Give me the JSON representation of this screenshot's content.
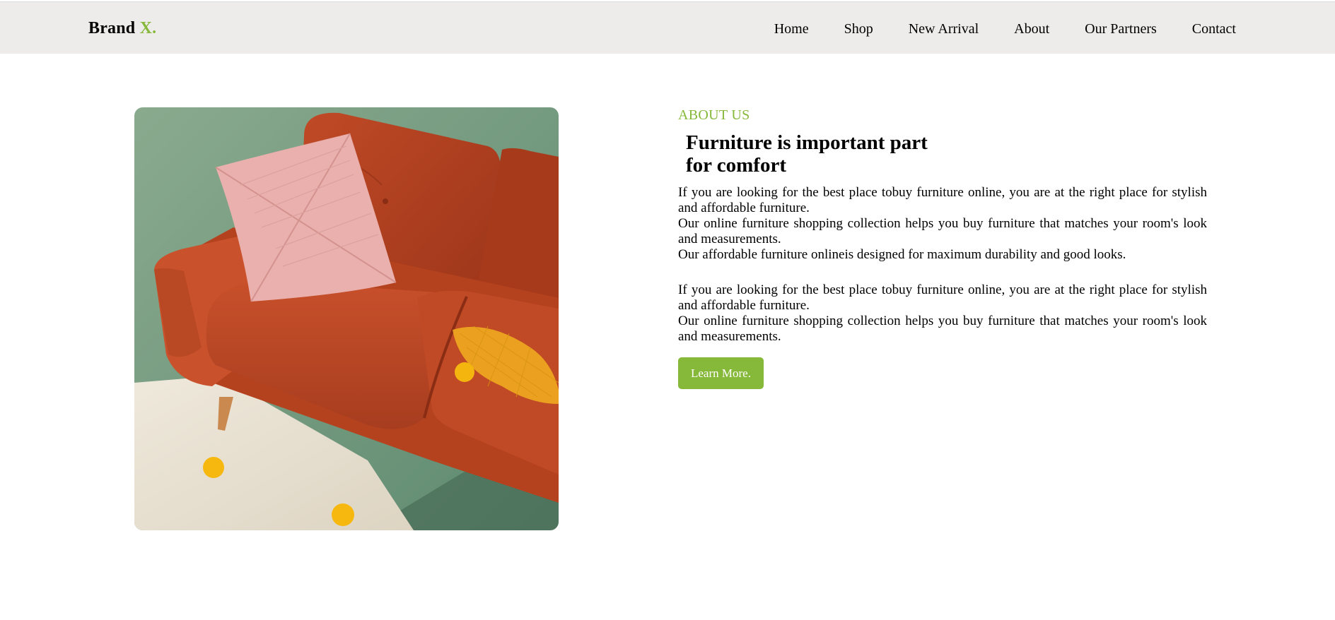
{
  "brand": {
    "name": "Brand",
    "accent": "X."
  },
  "nav": {
    "items": [
      "Home",
      "Shop",
      "New Arrival",
      "About",
      "Our Partners",
      "Contact"
    ]
  },
  "hero_image": {
    "icon": "sofa-photo"
  },
  "about": {
    "eyebrow": "ABOUT US",
    "heading_line1": "Furniture is important part",
    "heading_line2": "for comfort",
    "para1": [
      "If you are looking for the best place tobuy furniture online, you are at the right place for stylish and affordable furniture.",
      "Our online furniture shopping collection helps you buy furniture that matches your room's look and measurements.",
      "Our affordable furniture onlineis designed for maximum durability and good looks."
    ],
    "para2": [
      "If you are looking for the best place tobuy furniture online, you are at the right place for stylish and affordable furniture.",
      "Our online furniture shopping collection helps you buy furniture that matches your room's look and measurements."
    ],
    "button_label": "Learn More."
  },
  "colors": {
    "accent": "#86b83a",
    "navbar_bg": "#edecea"
  }
}
